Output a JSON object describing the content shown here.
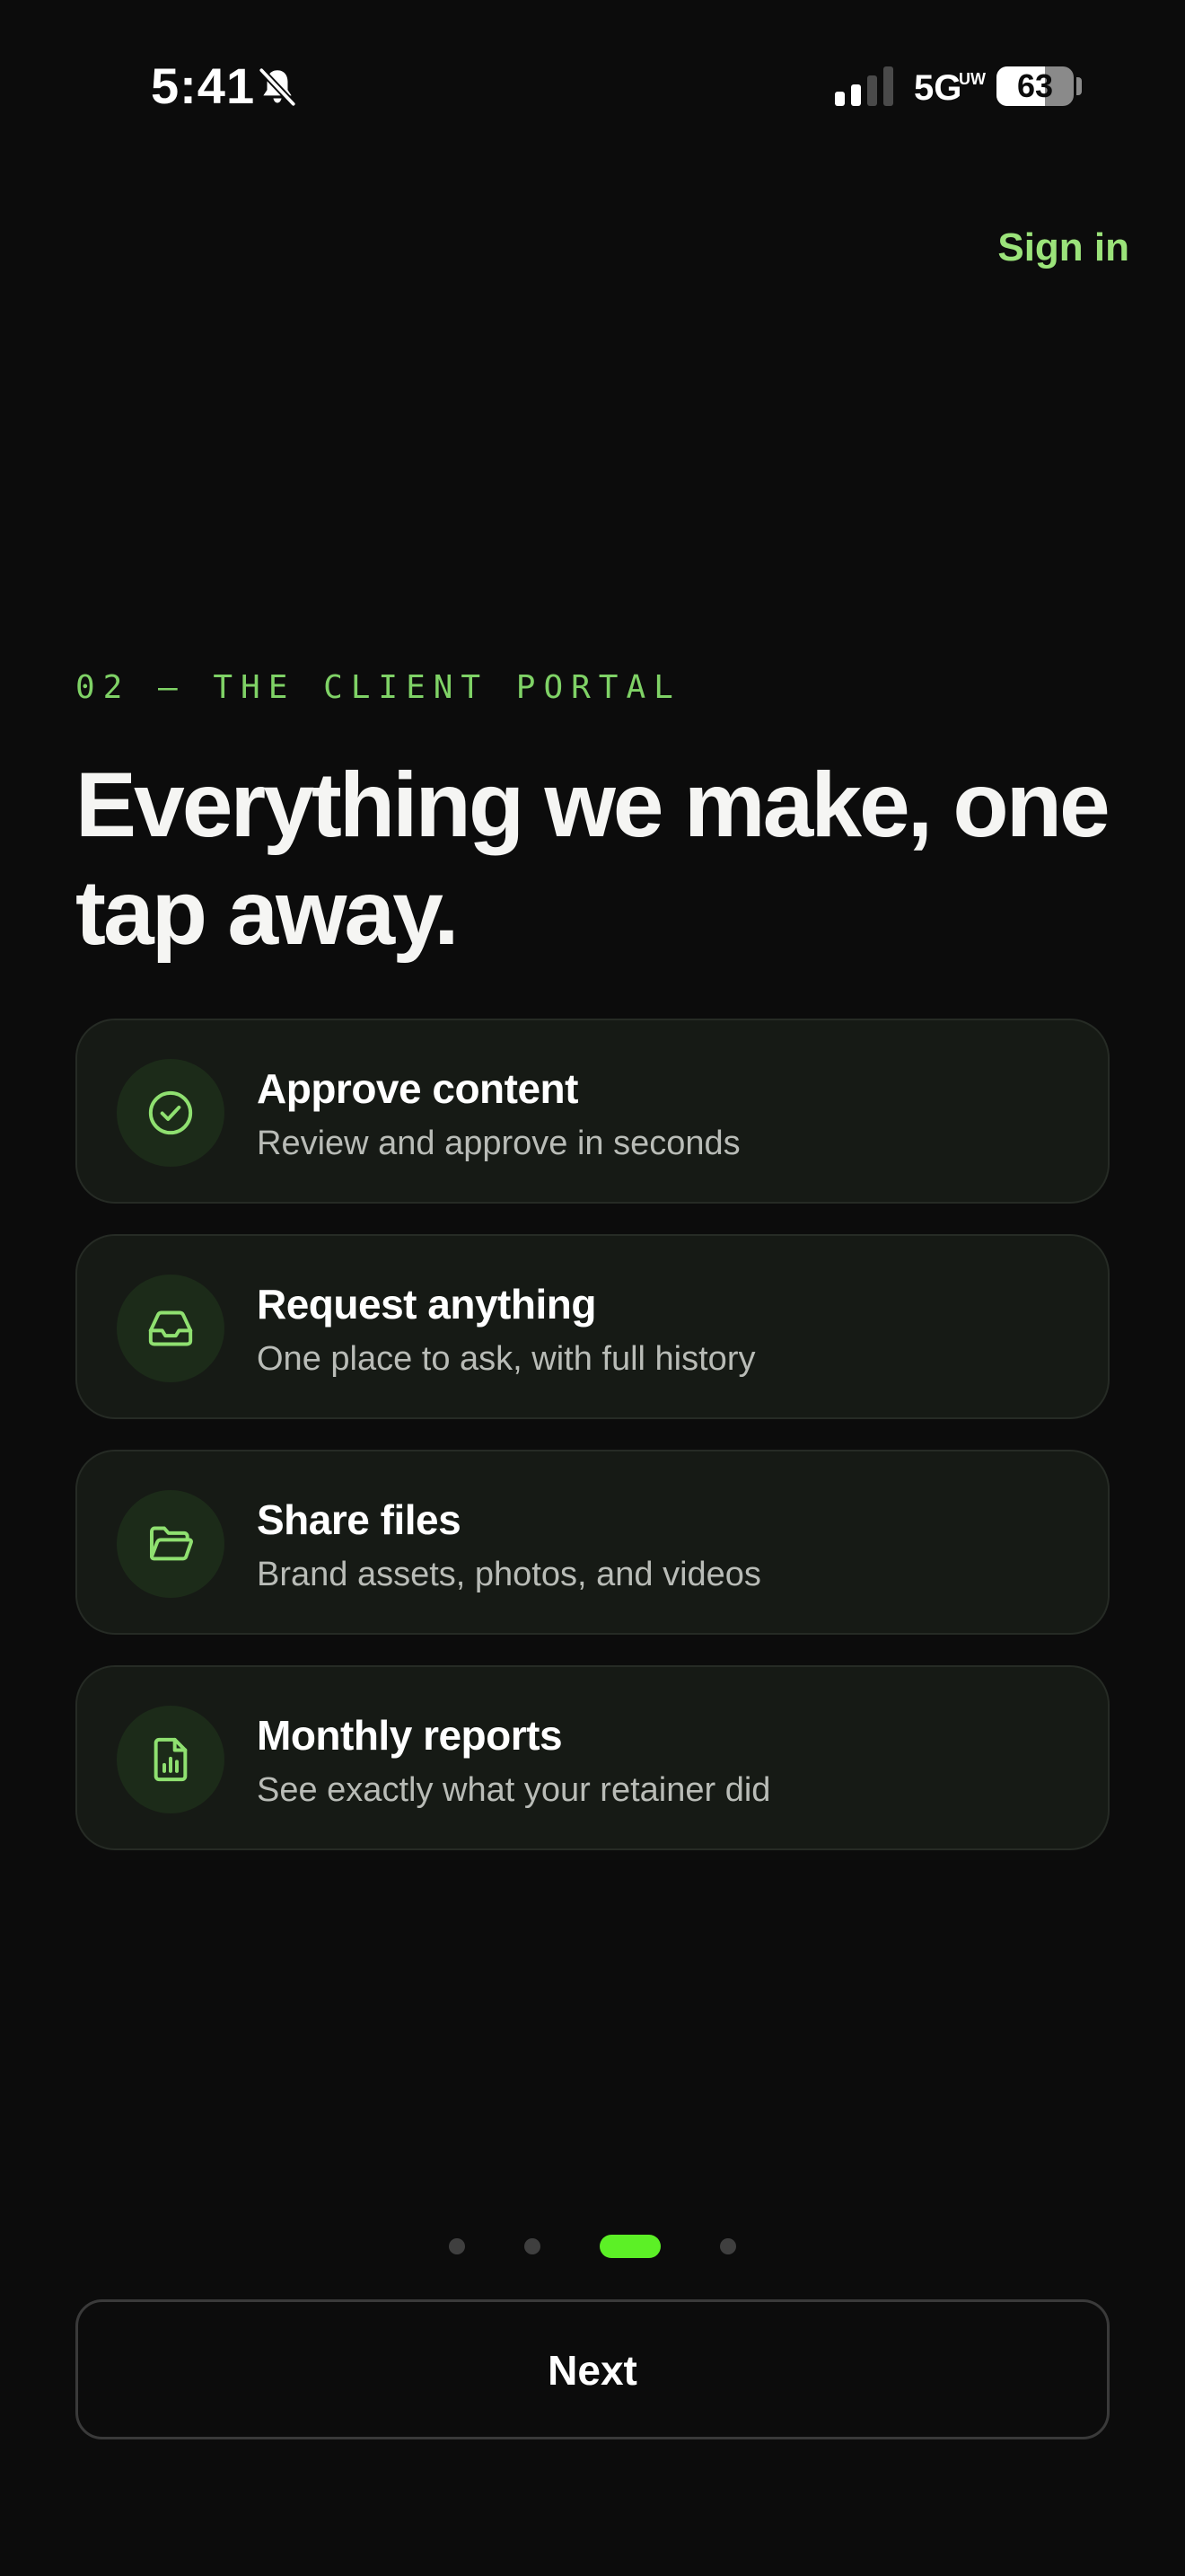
{
  "status_bar": {
    "time": "5:41",
    "network": "5G",
    "network_badge": "UW",
    "battery_percent": 63,
    "battery_label": "63",
    "signal_bars_active": 2,
    "signal_bars_total": 4,
    "icons": [
      "bell-slash-icon",
      "signal-icon",
      "battery-icon"
    ]
  },
  "header": {
    "sign_in_label": "Sign in"
  },
  "intro": {
    "eyebrow": "02 — THE CLIENT PORTAL",
    "headline": "Everything we make, one tap away."
  },
  "features": [
    {
      "title": "Approve content",
      "subtitle": "Review and approve in seconds",
      "icon": "check-circle-icon"
    },
    {
      "title": "Request anything",
      "subtitle": "One place to ask, with full history",
      "icon": "inbox-icon"
    },
    {
      "title": "Share files",
      "subtitle": "Brand assets, photos, and videos",
      "icon": "folder-open-icon"
    },
    {
      "title": "Monthly reports",
      "subtitle": "See exactly what your retainer did",
      "icon": "report-chart-icon"
    }
  ],
  "pager": {
    "total": 4,
    "current": 3
  },
  "footer": {
    "next_label": "Next"
  },
  "colors": {
    "background": "#0c0c0c",
    "accent": "#9be37a",
    "accent_bright": "#5cf026",
    "card_background": "#161a15",
    "card_border": "#262b25",
    "icon_circle": "#1c2b19",
    "subtitle_text": "#b9bcb7"
  }
}
